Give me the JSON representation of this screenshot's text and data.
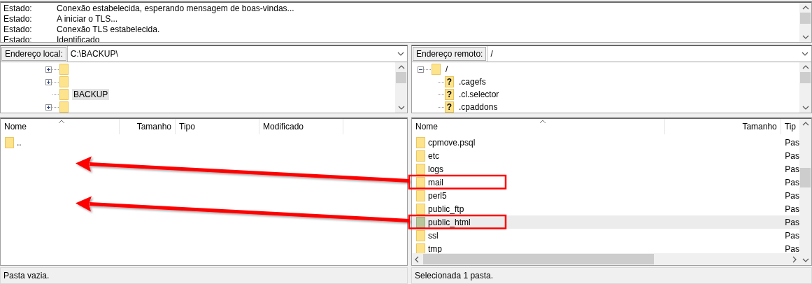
{
  "log": [
    {
      "label": "Estado:",
      "message": "Conexão estabelecida, esperando mensagem de boas-vindas..."
    },
    {
      "label": "Estado:",
      "message": "A iniciar o TLS..."
    },
    {
      "label": "Estado:",
      "message": "Conexão TLS estabelecida."
    },
    {
      "label": "Estado:",
      "message": "Identificado"
    }
  ],
  "local": {
    "address_label": "Endereço local:",
    "address": "C:\\BACKUP\\",
    "tree": [
      {
        "has_children": true,
        "selected": false
      },
      {
        "has_children": true,
        "selected": false
      },
      {
        "label": "BACKUP",
        "has_children": false,
        "selected": true
      },
      {
        "has_children": true,
        "selected": false
      }
    ],
    "columns": [
      "Nome",
      "Tamanho",
      "Tipo",
      "Modificado"
    ],
    "rows": [
      {
        "name": "..",
        "selected": false
      }
    ],
    "status": "Pasta vazia."
  },
  "remote": {
    "address_label": "Endereço remoto:",
    "address": "/",
    "tree": [
      {
        "label": "/",
        "kind": "folder",
        "expanded": true,
        "children": [
          {
            "label": ".cagefs",
            "kind": "unknown",
            "icon_glyph": "?"
          },
          {
            "label": ".cl.selector",
            "kind": "unknown",
            "icon_glyph": "?"
          },
          {
            "label": ".cpaddons",
            "kind": "unknown",
            "icon_glyph": "?"
          }
        ]
      }
    ],
    "columns": [
      "Nome",
      "Tamanho",
      "Tip"
    ],
    "rows": [
      {
        "name": "cpmove.psql",
        "type": "Pas",
        "selected": false,
        "annotated": false
      },
      {
        "name": "etc",
        "type": "Pas",
        "selected": false,
        "annotated": false
      },
      {
        "name": "logs",
        "type": "Pas",
        "selected": false,
        "annotated": false
      },
      {
        "name": "mail",
        "type": "Pas",
        "selected": false,
        "annotated": true
      },
      {
        "name": "perl5",
        "type": "Pas",
        "selected": false,
        "annotated": false
      },
      {
        "name": "public_ftp",
        "type": "Pas",
        "selected": false,
        "annotated": false
      },
      {
        "name": "public_html",
        "type": "Pas",
        "selected": true,
        "annotated": true
      },
      {
        "name": "ssl",
        "type": "Pas",
        "selected": false,
        "annotated": false
      },
      {
        "name": "tmp",
        "type": "Pas",
        "selected": false,
        "annotated": false
      }
    ],
    "status": "Selecionada 1 pasta."
  }
}
